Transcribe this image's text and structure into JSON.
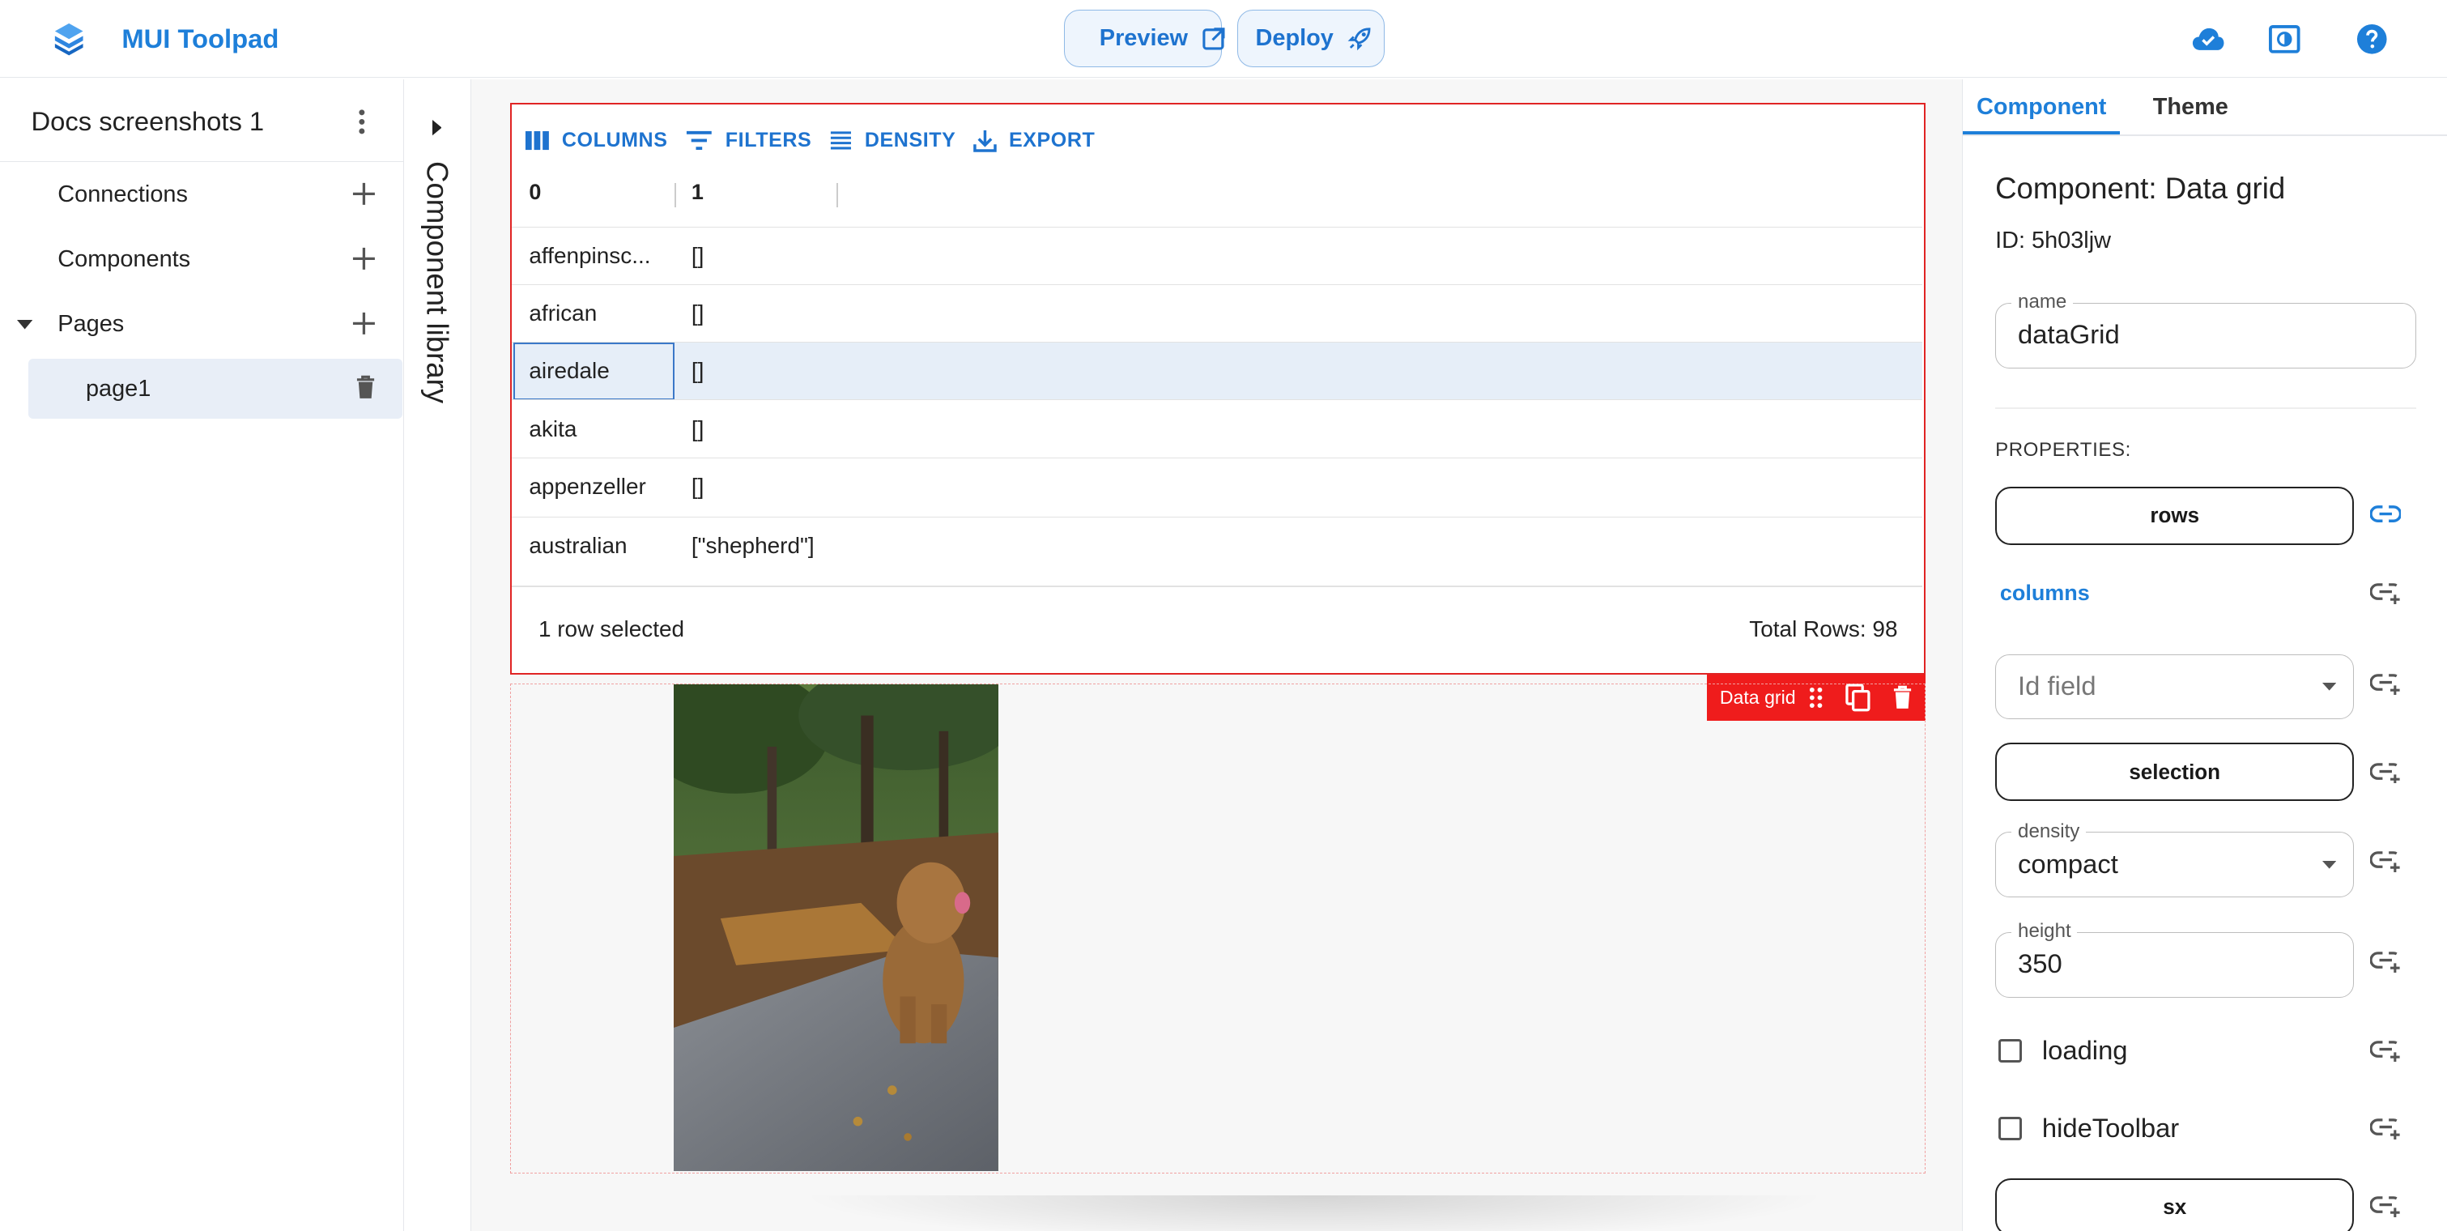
{
  "header": {
    "app_title": "MUI Toolpad",
    "preview_label": "Preview",
    "deploy_label": "Deploy"
  },
  "sidebar": {
    "project_name": "Docs screenshots 1",
    "connections_label": "Connections",
    "components_label": "Components",
    "pages_label": "Pages",
    "pages": [
      {
        "label": "page1"
      }
    ]
  },
  "library": {
    "label": "Component library"
  },
  "grid": {
    "toolbar": {
      "columns": "COLUMNS",
      "filters": "FILTERS",
      "density": "DENSITY",
      "export": "EXPORT"
    },
    "headers": [
      "0",
      "1"
    ],
    "rows": [
      {
        "c0": "affenpinsc...",
        "c1": "[]"
      },
      {
        "c0": "african",
        "c1": "[]"
      },
      {
        "c0": "airedale",
        "c1": "[]",
        "selected": true
      },
      {
        "c0": "akita",
        "c1": "[]"
      },
      {
        "c0": "appenzeller",
        "c1": "[]"
      },
      {
        "c0": "australian",
        "c1": "[\"shepherd\"]"
      }
    ],
    "footer_selected": "1 row selected",
    "footer_total": "Total Rows: 98",
    "selection_tag": "Data grid"
  },
  "panel": {
    "tabs": [
      "Component",
      "Theme"
    ],
    "active_tab": "Component",
    "title": "Component: Data grid",
    "id_text": "ID: 5h03ljw",
    "name_label": "name",
    "name_value": "dataGrid",
    "properties_label": "PROPERTIES:",
    "rows_button": "rows",
    "columns_link": "columns",
    "idfield_placeholder": "Id field",
    "selection_button": "selection",
    "density_label": "density",
    "density_value": "compact",
    "height_label": "height",
    "height_value": "350",
    "loading_label": "loading",
    "hidetoolbar_label": "hideToolbar",
    "sx_button": "sx"
  },
  "colors": {
    "accent": "#1e7fd9",
    "selection": "#e02424",
    "row_selected": "#e6eef8"
  }
}
